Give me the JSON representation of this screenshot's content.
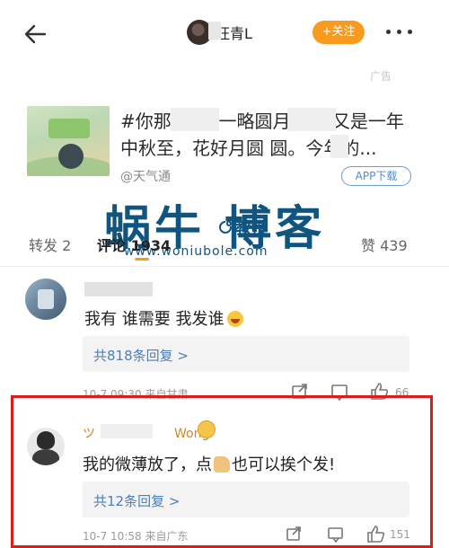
{
  "header": {
    "user_name": "旺青L",
    "follow_label": "+关注",
    "back_icon": "back-arrow-icon",
    "more_icon": "more-dots-icon"
  },
  "ad": {
    "label": "广告",
    "text": "#你那 昆吕 一略圆月真谷 又是一年中秋至，花好月圆 圆。今年的...",
    "source": "@天气通",
    "app_button": "APP下载"
  },
  "watermark": {
    "main": "蜗牛 博客",
    "middle": "教授",
    "url": "www.woniubole.com"
  },
  "tabs": {
    "repost": "转发 2",
    "comment": "评论 1934",
    "likes": "赞 439",
    "accent": "#f79a1e"
  },
  "comments": [
    {
      "text": "我有 谁需要 我发谁",
      "emoji": "grin-emoji",
      "replies": "共818条回复 >",
      "meta": "10-7 09:30 来自甘肃",
      "likes": "66"
    },
    {
      "name_prefix": "ツ",
      "name_suffix": "Wong",
      "text_before": "我的微薄放了，点",
      "text_after": "也可以挨个发!",
      "replies": "共12条回复 >",
      "meta": "10-7 10:58 来自广东",
      "likes": "151"
    }
  ],
  "colors": {
    "link": "#4d7fb5",
    "highlight_border": "#d81e1e",
    "watermark": "#10557f"
  }
}
